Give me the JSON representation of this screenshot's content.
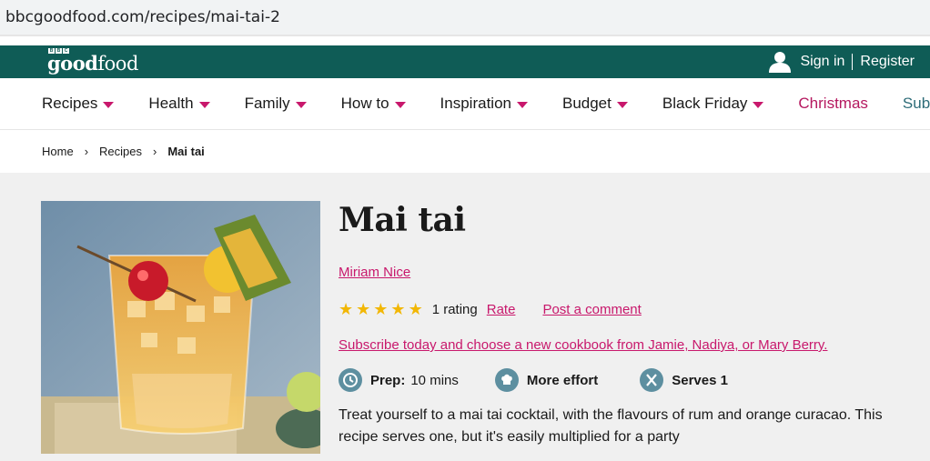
{
  "browser": {
    "url": "bbcgoodfood.com/recipes/mai-tai-2"
  },
  "header": {
    "logo_bbc": [
      "B",
      "B",
      "C"
    ],
    "logo_good": "good",
    "logo_food": "food",
    "sign_in": "Sign in",
    "register": "Register"
  },
  "nav": {
    "items": [
      {
        "label": "Recipes"
      },
      {
        "label": "Health"
      },
      {
        "label": "Family"
      },
      {
        "label": "How to"
      },
      {
        "label": "Inspiration"
      },
      {
        "label": "Budget"
      },
      {
        "label": "Black Friday"
      },
      {
        "label": "Christmas"
      },
      {
        "label": "Subscribe"
      }
    ]
  },
  "breadcrumb": {
    "home": "Home",
    "recipes": "Recipes",
    "current": "Mai tai"
  },
  "recipe": {
    "title": "Mai tai",
    "author": "Miriam Nice",
    "rating_stars": 5,
    "rating_count": "1 rating",
    "rate_label": "Rate",
    "comment_label": "Post a comment",
    "promo": "Subscribe today and choose a new cookbook from Jamie, Nadiya, or Mary Berry.",
    "prep_label": "Prep:",
    "prep_value": "10 mins",
    "difficulty": "More effort",
    "serves": "Serves 1",
    "description": "Treat yourself to a mai tai cocktail, with the flavours of rum and orange curacao. This recipe serves one, but it's easily multiplied for a party"
  },
  "colors": {
    "brand_green": "#0f5c56",
    "accent_pink": "#c8186c",
    "star": "#f2b705",
    "icon_blue": "#5d8fa0"
  },
  "icons": [
    "user-icon",
    "caret-down-icon",
    "chevron-right-icon",
    "star-icon",
    "clock-icon",
    "chef-hat-icon",
    "cutlery-icon"
  ]
}
